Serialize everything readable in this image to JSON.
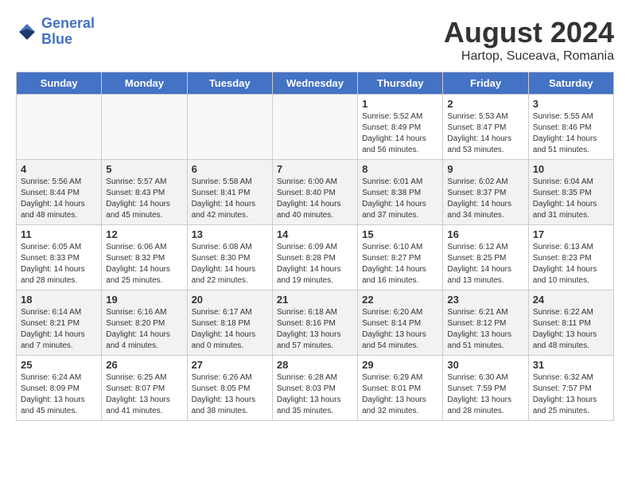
{
  "header": {
    "logo_line1": "General",
    "logo_line2": "Blue",
    "main_title": "August 2024",
    "subtitle": "Hartop, Suceava, Romania"
  },
  "days_of_week": [
    "Sunday",
    "Monday",
    "Tuesday",
    "Wednesday",
    "Thursday",
    "Friday",
    "Saturday"
  ],
  "weeks": [
    [
      {
        "day": "",
        "info": "",
        "empty": true
      },
      {
        "day": "",
        "info": "",
        "empty": true
      },
      {
        "day": "",
        "info": "",
        "empty": true
      },
      {
        "day": "",
        "info": "",
        "empty": true
      },
      {
        "day": "1",
        "info": "Sunrise: 5:52 AM\nSunset: 8:49 PM\nDaylight: 14 hours\nand 56 minutes."
      },
      {
        "day": "2",
        "info": "Sunrise: 5:53 AM\nSunset: 8:47 PM\nDaylight: 14 hours\nand 53 minutes."
      },
      {
        "day": "3",
        "info": "Sunrise: 5:55 AM\nSunset: 8:46 PM\nDaylight: 14 hours\nand 51 minutes."
      }
    ],
    [
      {
        "day": "4",
        "info": "Sunrise: 5:56 AM\nSunset: 8:44 PM\nDaylight: 14 hours\nand 48 minutes."
      },
      {
        "day": "5",
        "info": "Sunrise: 5:57 AM\nSunset: 8:43 PM\nDaylight: 14 hours\nand 45 minutes."
      },
      {
        "day": "6",
        "info": "Sunrise: 5:58 AM\nSunset: 8:41 PM\nDaylight: 14 hours\nand 42 minutes."
      },
      {
        "day": "7",
        "info": "Sunrise: 6:00 AM\nSunset: 8:40 PM\nDaylight: 14 hours\nand 40 minutes."
      },
      {
        "day": "8",
        "info": "Sunrise: 6:01 AM\nSunset: 8:38 PM\nDaylight: 14 hours\nand 37 minutes."
      },
      {
        "day": "9",
        "info": "Sunrise: 6:02 AM\nSunset: 8:37 PM\nDaylight: 14 hours\nand 34 minutes."
      },
      {
        "day": "10",
        "info": "Sunrise: 6:04 AM\nSunset: 8:35 PM\nDaylight: 14 hours\nand 31 minutes."
      }
    ],
    [
      {
        "day": "11",
        "info": "Sunrise: 6:05 AM\nSunset: 8:33 PM\nDaylight: 14 hours\nand 28 minutes."
      },
      {
        "day": "12",
        "info": "Sunrise: 6:06 AM\nSunset: 8:32 PM\nDaylight: 14 hours\nand 25 minutes."
      },
      {
        "day": "13",
        "info": "Sunrise: 6:08 AM\nSunset: 8:30 PM\nDaylight: 14 hours\nand 22 minutes."
      },
      {
        "day": "14",
        "info": "Sunrise: 6:09 AM\nSunset: 8:28 PM\nDaylight: 14 hours\nand 19 minutes."
      },
      {
        "day": "15",
        "info": "Sunrise: 6:10 AM\nSunset: 8:27 PM\nDaylight: 14 hours\nand 16 minutes."
      },
      {
        "day": "16",
        "info": "Sunrise: 6:12 AM\nSunset: 8:25 PM\nDaylight: 14 hours\nand 13 minutes."
      },
      {
        "day": "17",
        "info": "Sunrise: 6:13 AM\nSunset: 8:23 PM\nDaylight: 14 hours\nand 10 minutes."
      }
    ],
    [
      {
        "day": "18",
        "info": "Sunrise: 6:14 AM\nSunset: 8:21 PM\nDaylight: 14 hours\nand 7 minutes."
      },
      {
        "day": "19",
        "info": "Sunrise: 6:16 AM\nSunset: 8:20 PM\nDaylight: 14 hours\nand 4 minutes."
      },
      {
        "day": "20",
        "info": "Sunrise: 6:17 AM\nSunset: 8:18 PM\nDaylight: 14 hours\nand 0 minutes."
      },
      {
        "day": "21",
        "info": "Sunrise: 6:18 AM\nSunset: 8:16 PM\nDaylight: 13 hours\nand 57 minutes."
      },
      {
        "day": "22",
        "info": "Sunrise: 6:20 AM\nSunset: 8:14 PM\nDaylight: 13 hours\nand 54 minutes."
      },
      {
        "day": "23",
        "info": "Sunrise: 6:21 AM\nSunset: 8:12 PM\nDaylight: 13 hours\nand 51 minutes."
      },
      {
        "day": "24",
        "info": "Sunrise: 6:22 AM\nSunset: 8:11 PM\nDaylight: 13 hours\nand 48 minutes."
      }
    ],
    [
      {
        "day": "25",
        "info": "Sunrise: 6:24 AM\nSunset: 8:09 PM\nDaylight: 13 hours\nand 45 minutes."
      },
      {
        "day": "26",
        "info": "Sunrise: 6:25 AM\nSunset: 8:07 PM\nDaylight: 13 hours\nand 41 minutes."
      },
      {
        "day": "27",
        "info": "Sunrise: 6:26 AM\nSunset: 8:05 PM\nDaylight: 13 hours\nand 38 minutes."
      },
      {
        "day": "28",
        "info": "Sunrise: 6:28 AM\nSunset: 8:03 PM\nDaylight: 13 hours\nand 35 minutes."
      },
      {
        "day": "29",
        "info": "Sunrise: 6:29 AM\nSunset: 8:01 PM\nDaylight: 13 hours\nand 32 minutes."
      },
      {
        "day": "30",
        "info": "Sunrise: 6:30 AM\nSunset: 7:59 PM\nDaylight: 13 hours\nand 28 minutes."
      },
      {
        "day": "31",
        "info": "Sunrise: 6:32 AM\nSunset: 7:57 PM\nDaylight: 13 hours\nand 25 minutes."
      }
    ]
  ]
}
